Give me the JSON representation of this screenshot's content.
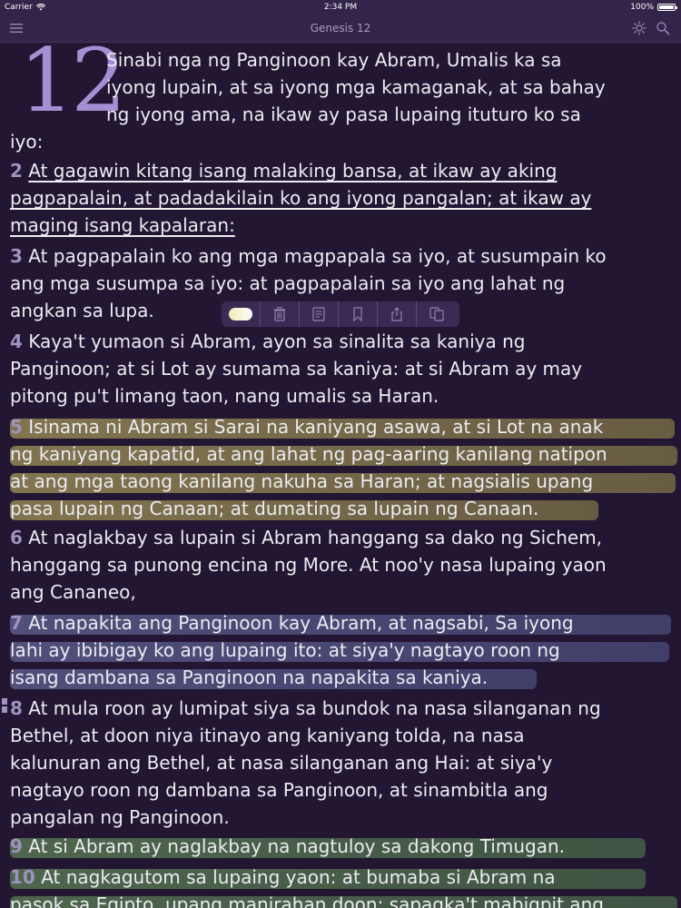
{
  "status_bar": {
    "carrier": "Carrier",
    "time": "2:34 PM",
    "battery": "100%"
  },
  "nav": {
    "title": "Genesis 12"
  },
  "chapter": {
    "number": "12"
  },
  "verses": [
    {
      "number": "",
      "lines": [
        "Sinabi nga ng Panginoon kay Abram, Umalis ka sa",
        "iyong lupain, at sa iyong mga kamaganak, at sa bahay",
        "ng iyong ama, na ikaw ay pasa lupaing ituturo ko sa",
        "iyo:"
      ]
    },
    {
      "number": "2",
      "style": "underline",
      "lines": [
        "At gagawin kitang isang malaking bansa, at ikaw ay aking",
        "pagpapalain, at padadakilain ko ang iyong pangalan; at ikaw ay",
        "maging isang kapalaran:"
      ]
    },
    {
      "number": "3",
      "lines": [
        "At pagpapalain ko ang mga magpapala sa iyo, at susumpain ko",
        "ang mga susumpa sa iyo: at pagpapalain sa iyo ang lahat ng",
        "angkan sa lupa."
      ]
    },
    {
      "number": "4",
      "lines": [
        "Kaya't yumaon si Abram, ayon sa sinalita sa kaniya ng",
        "Panginoon; at si Lot ay sumama sa kaniya: at si Abram ay may",
        "pitong pu't limang taon, nang umalis sa Haran."
      ]
    },
    {
      "number": "5",
      "style": "highlight-gold",
      "lines": [
        "Isinama ni Abram si Sarai na kaniyang asawa, at si Lot na anak",
        "ng kaniyang kapatid, at ang lahat ng pag-aaring kanilang natipon",
        "at ang mga taong kanilang nakuha sa Haran; at nagsialis upang",
        "pasa lupain ng Canaan; at dumating sa lupain ng Canaan."
      ]
    },
    {
      "number": "6",
      "lines": [
        "At naglakbay sa lupain si Abram hanggang sa dako ng Sichem,",
        "hanggang sa punong encina ng More. At noo'y nasa lupaing yaon",
        "ang Cananeo,"
      ]
    },
    {
      "number": "7",
      "style": "highlight-blue",
      "lines": [
        "At napakita ang Panginoon kay Abram, at nagsabi, Sa iyong",
        "lahi ay ibibigay ko ang lupaing ito: at siya'y nagtayo roon ng",
        "isang dambana sa Panginoon na napakita sa kaniya."
      ]
    },
    {
      "number": "8",
      "lines": [
        "At mula roon ay lumipat siya sa bundok na nasa silanganan ng",
        "Bethel, at doon niya itinayo ang kaniyang tolda, na nasa",
        "kalunuran ang Bethel, at nasa silanganan ang Hai: at siya'y",
        "nagtayo roon ng dambana sa Panginoon, at sinambitla ang",
        "pangalan ng Panginoon."
      ]
    },
    {
      "number": "9",
      "style": "highlight-green",
      "lines": [
        "At si Abram ay naglakbay na nagtuloy sa dakong Timugan."
      ]
    },
    {
      "number": "10",
      "style": "highlight-green",
      "lines": [
        "At nagkagutom sa lupaing yaon: at bumaba si Abram na",
        "pasok sa Egipto, upang manirahan doon; sapagka't mabigpit ang"
      ]
    }
  ],
  "action_bar": {
    "actions": [
      "highlight",
      "delete",
      "note",
      "bookmark",
      "share",
      "copy"
    ]
  },
  "colors": {
    "background": "#221633",
    "chapter_number": "#a48fd3",
    "verse_number": "#9f92bf",
    "highlight_gold": "#928554",
    "highlight_blue": "#565682",
    "highlight_green": "#546e50"
  }
}
